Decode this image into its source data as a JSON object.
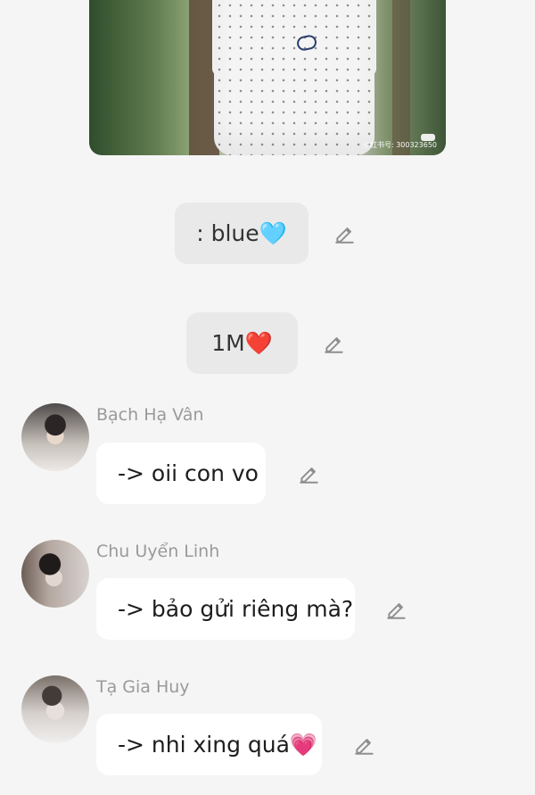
{
  "media": {
    "watermark": "小红书号: 300323650"
  },
  "messages": {
    "message_1": ": blue🩵",
    "message_2": "1M❤️"
  },
  "comments": [
    {
      "author": "Bạch Hạ Vân",
      "text": "-> oii con vo"
    },
    {
      "author": "Chu Uyển Linh",
      "text": "-> bảo gửi riêng mà?"
    },
    {
      "author": "Tạ Gia Huy",
      "text": "-> nhi xing quá💗"
    }
  ],
  "icons": {
    "edit": "pencil-edit-icon",
    "logo": "shirt-logo-icon"
  },
  "colors": {
    "background": "#f5f5f5",
    "message_pill": "#e9e9e9",
    "comment_bubble": "#ffffff",
    "muted_text": "#9a9a9a",
    "primary_text": "#1d1d1d"
  }
}
